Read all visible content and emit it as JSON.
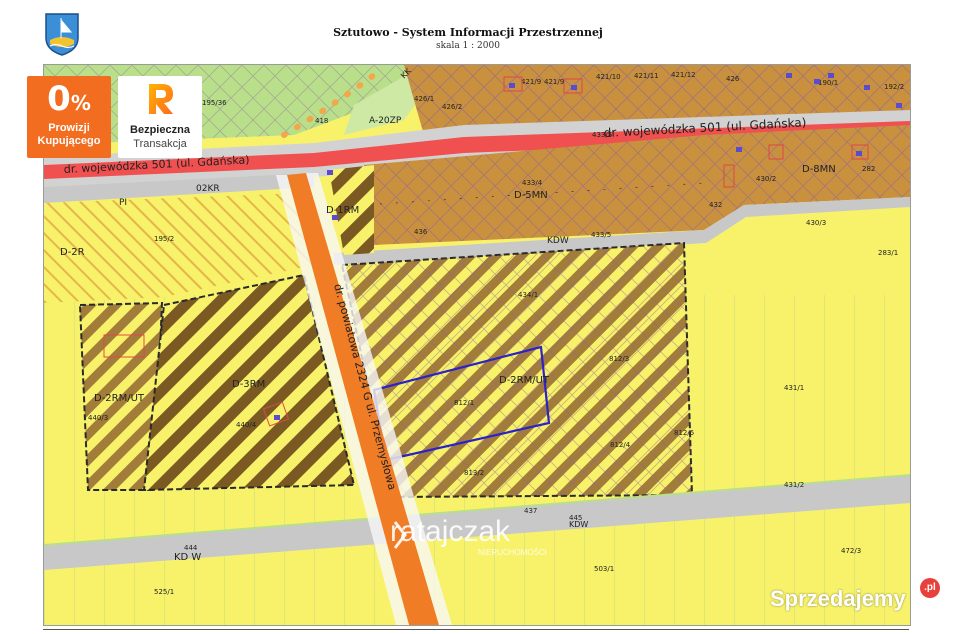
{
  "header": {
    "title": "Sztutowo - System Informacji Przestrzennej",
    "scale": "skala 1 : 2000"
  },
  "badges": {
    "prowizja": {
      "big": "0",
      "percent": "%",
      "line1": "Prowizji",
      "line2": "Kupującego",
      "color": "#f26d1f"
    },
    "bezpieczna": {
      "line1": "Bezpieczna",
      "line2": "Transakcja"
    }
  },
  "watermark": {
    "brand": "ratajczak",
    "sub": "NIERUCHOMOŚCI"
  },
  "site_watermark": {
    "text": "Sprzedajemy",
    "suffix": ".pl"
  },
  "map": {
    "colors": {
      "agricultural": "#f7f26a",
      "residential": "#c9913e",
      "road_main": "#f05050",
      "road_local": "#c8c8c8",
      "road_county": "#f07c26",
      "greenery": "#b9df8a",
      "zone_boundary": "#000000",
      "plot_lines": "#7fb9a8",
      "hatch_purple": "#8a5fa0",
      "selection": "#2b22c8"
    },
    "road_labels": {
      "voivodeship_1": "dr. wojewódzka 501 (ul. Gdańska)",
      "voivodeship_2": "dr. wojewódzka 501 (ul. Gdańska)",
      "county": "dr. powiatowa 2324 G ul. Przemysłowa"
    },
    "zones": [
      "D-2R",
      "D-3RM",
      "D-2RM/UT",
      "D-2RM/UT",
      "D-5MN",
      "D-8MN",
      "D-1RM",
      "A-20ZP",
      "KDW",
      "KD W",
      "02KR",
      "PI",
      "KK",
      "KDW"
    ],
    "parcels": [
      "426",
      "421/9",
      "421/10",
      "421/11",
      "421/12",
      "426/1",
      "418",
      "190/1",
      "192/2",
      "195/36",
      "433/5",
      "433/4",
      "430/2",
      "432",
      "433/5",
      "430/3",
      "283/1",
      "195/2",
      "434/1",
      "812/3",
      "812/1",
      "431/1",
      "440/3",
      "440/4",
      "812/4",
      "812/5",
      "813/2",
      "431/2",
      "437",
      "445",
      "444",
      "472/3",
      "503/1",
      "525/1",
      "436",
      "426/2",
      "282",
      "421/9"
    ]
  }
}
